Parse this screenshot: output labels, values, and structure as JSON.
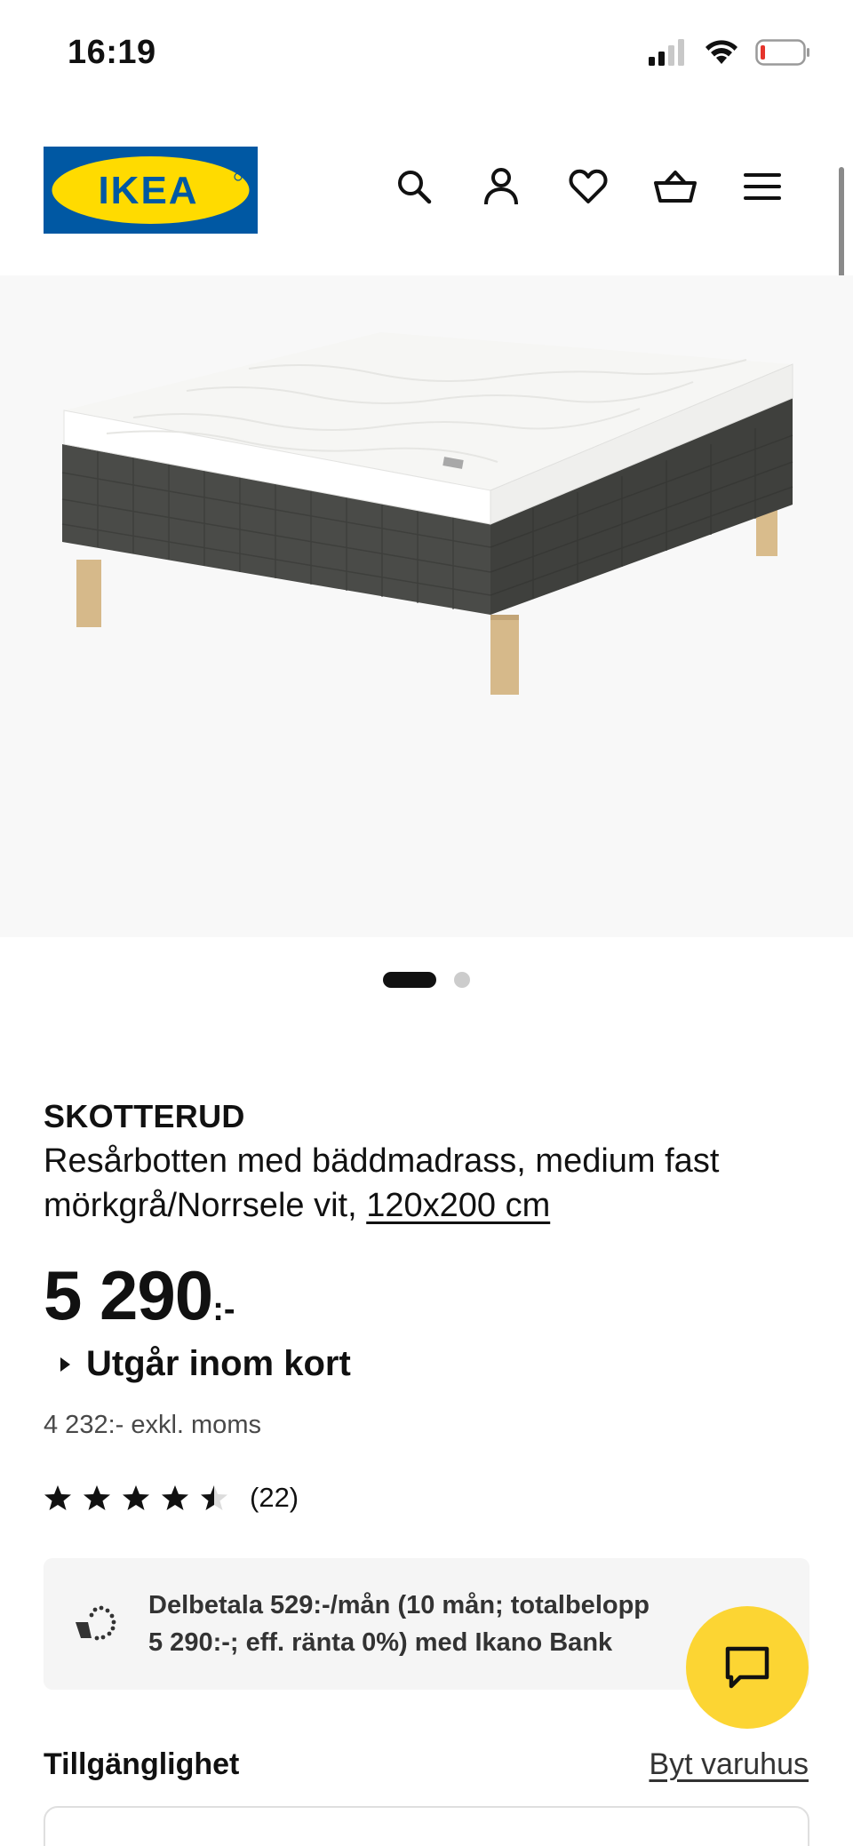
{
  "status_bar": {
    "time": "16:19"
  },
  "header": {
    "logo_text": "IKEA",
    "icons": [
      "search-icon",
      "user-icon",
      "heart-icon",
      "cart-icon",
      "menu-icon"
    ]
  },
  "carousel": {
    "image_count": 2,
    "active_index": 0
  },
  "product": {
    "name": "SKOTTERUD",
    "description_line1": "Resårbotten med bäddmadrass, medium fast",
    "description_line2": "mörkgrå/Norrsele vit,",
    "size": "120x200 cm",
    "price": "5 290",
    "price_suffix": ":-",
    "discontinued_label": "Utgår inom kort",
    "price_excl_vat": "4 232:- exkl. moms",
    "rating_value": 4.5,
    "rating_max": 5,
    "review_count": "(22)"
  },
  "financing": {
    "line1": "Delbetala 529:-/mån (10 mån; totalbelopp",
    "line2": "5 290:-; eff. ränta 0%) med Ikano Bank"
  },
  "availability": {
    "title": "Tillgänglighet",
    "change_store_label": "Byt varuhus"
  },
  "colors": {
    "ikea_blue": "#0058a3",
    "ikea_yellow": "#ffdb00",
    "chat_button": "#fcd533",
    "mattress_fabric": "#4a4b48",
    "wood_legs": "#d6b98a"
  }
}
